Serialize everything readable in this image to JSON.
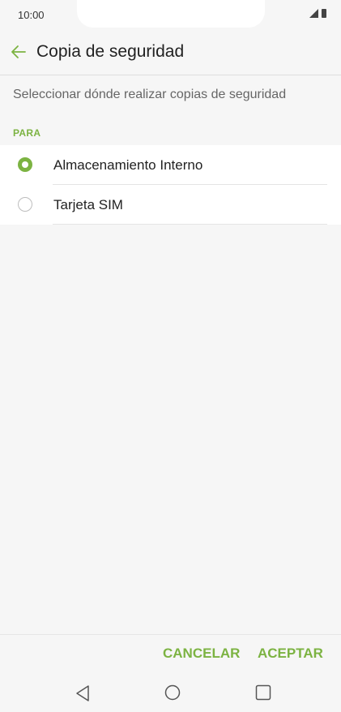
{
  "status_bar": {
    "time": "10:00"
  },
  "header": {
    "title": "Copia de seguridad"
  },
  "subtitle": "Seleccionar dónde realizar copias de seguridad",
  "section": {
    "label": "PARA"
  },
  "options": [
    {
      "label": "Almacenamiento Interno",
      "selected": true
    },
    {
      "label": "Tarjeta SIM",
      "selected": false
    }
  ],
  "actions": {
    "cancel": "CANCELAR",
    "accept": "ACEPTAR"
  },
  "colors": {
    "accent": "#7cb342",
    "background": "#f6f6f6"
  },
  "icons": {
    "back": "arrow-left-icon",
    "nav_back": "triangle-back-icon",
    "nav_home": "circle-home-icon",
    "nav_recent": "square-recent-icon"
  }
}
